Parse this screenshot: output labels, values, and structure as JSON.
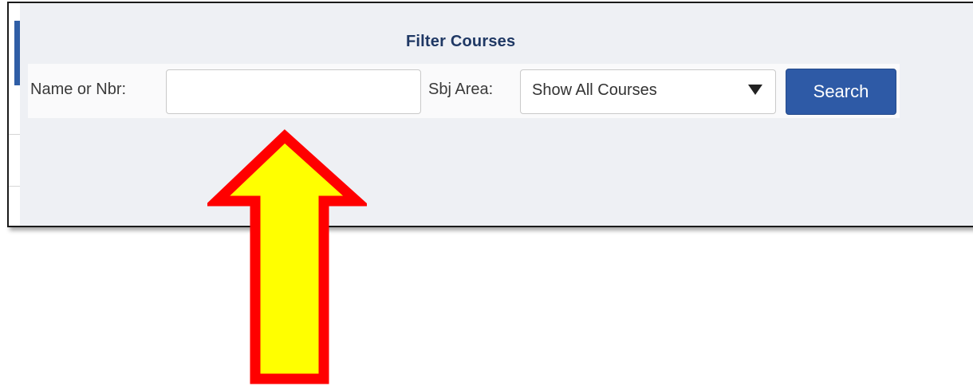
{
  "filter": {
    "title": "Filter Courses",
    "name_label": "Name or Nbr:",
    "name_value": "",
    "subject_label": "Sbj Area:",
    "subject_selected": "Show All Courses",
    "search_label": "Search"
  },
  "icons": {
    "dropdown": "caret-down-icon",
    "annotation": "up-arrow-icon"
  },
  "colors": {
    "panel_bg": "#eef0f4",
    "title": "#1f3864",
    "button": "#2e5aa6",
    "arrow_fill": "#ffff00",
    "arrow_stroke": "#ff0000"
  }
}
